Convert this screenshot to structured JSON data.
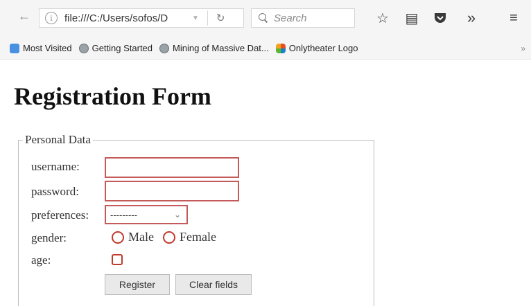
{
  "browser": {
    "url": "file:///C:/Users/sofos/D",
    "search_placeholder": "Search",
    "bookmarks": [
      "Most Visited",
      "Getting Started",
      "Mining of Massive Dat...",
      "Onlytheater Logo"
    ],
    "bookmarks_more": "»"
  },
  "page": {
    "title": "Registration Form",
    "legend": "Personal Data",
    "labels": {
      "username": "username:",
      "password": "password:",
      "preferences": "preferences:",
      "gender": "gender:",
      "age": "age:"
    },
    "preferences_selected": "---------",
    "gender_options": [
      "Male",
      "Female"
    ],
    "buttons": {
      "register": "Register",
      "clear": "Clear fields"
    }
  },
  "colors": {
    "invalid_border": "#c45a5a",
    "radio_border": "#c0392b"
  },
  "icons": [
    "back-arrow-icon",
    "info-icon",
    "dropdown-arrow-icon",
    "reload-icon",
    "search-icon",
    "star-icon",
    "clipboard-icon",
    "pocket-icon",
    "overflow-icon",
    "menu-icon",
    "most-visited-icon",
    "globe-icon",
    "joomla-icon"
  ]
}
